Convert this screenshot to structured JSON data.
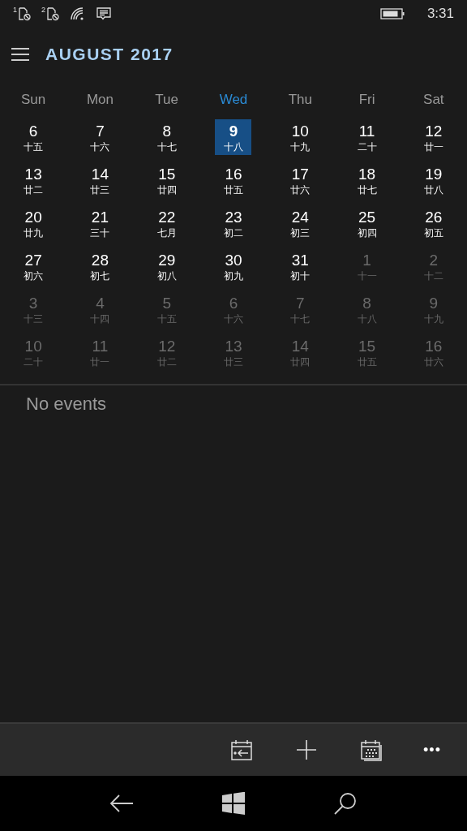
{
  "status_bar": {
    "sims": [
      "1",
      "2"
    ],
    "time": "3:31"
  },
  "header": {
    "title": "AUGUST 2017"
  },
  "weekdays": [
    {
      "label": "Sun",
      "selected": false
    },
    {
      "label": "Mon",
      "selected": false
    },
    {
      "label": "Tue",
      "selected": false
    },
    {
      "label": "Wed",
      "selected": true
    },
    {
      "label": "Thu",
      "selected": false
    },
    {
      "label": "Fri",
      "selected": false
    },
    {
      "label": "Sat",
      "selected": false
    }
  ],
  "weeks": [
    [
      {
        "day": "6",
        "lunar": "十五",
        "in_month": true,
        "selected": false
      },
      {
        "day": "7",
        "lunar": "十六",
        "in_month": true,
        "selected": false
      },
      {
        "day": "8",
        "lunar": "十七",
        "in_month": true,
        "selected": false
      },
      {
        "day": "9",
        "lunar": "十八",
        "in_month": true,
        "selected": true
      },
      {
        "day": "10",
        "lunar": "十九",
        "in_month": true,
        "selected": false
      },
      {
        "day": "11",
        "lunar": "二十",
        "in_month": true,
        "selected": false
      },
      {
        "day": "12",
        "lunar": "廿一",
        "in_month": true,
        "selected": false
      }
    ],
    [
      {
        "day": "13",
        "lunar": "廿二",
        "in_month": true,
        "selected": false
      },
      {
        "day": "14",
        "lunar": "廿三",
        "in_month": true,
        "selected": false
      },
      {
        "day": "15",
        "lunar": "廿四",
        "in_month": true,
        "selected": false
      },
      {
        "day": "16",
        "lunar": "廿五",
        "in_month": true,
        "selected": false
      },
      {
        "day": "17",
        "lunar": "廿六",
        "in_month": true,
        "selected": false
      },
      {
        "day": "18",
        "lunar": "廿七",
        "in_month": true,
        "selected": false
      },
      {
        "day": "19",
        "lunar": "廿八",
        "in_month": true,
        "selected": false
      }
    ],
    [
      {
        "day": "20",
        "lunar": "廿九",
        "in_month": true,
        "selected": false
      },
      {
        "day": "21",
        "lunar": "三十",
        "in_month": true,
        "selected": false
      },
      {
        "day": "22",
        "lunar": "七月",
        "in_month": true,
        "selected": false
      },
      {
        "day": "23",
        "lunar": "初二",
        "in_month": true,
        "selected": false
      },
      {
        "day": "24",
        "lunar": "初三",
        "in_month": true,
        "selected": false
      },
      {
        "day": "25",
        "lunar": "初四",
        "in_month": true,
        "selected": false
      },
      {
        "day": "26",
        "lunar": "初五",
        "in_month": true,
        "selected": false
      }
    ],
    [
      {
        "day": "27",
        "lunar": "初六",
        "in_month": true,
        "selected": false
      },
      {
        "day": "28",
        "lunar": "初七",
        "in_month": true,
        "selected": false
      },
      {
        "day": "29",
        "lunar": "初八",
        "in_month": true,
        "selected": false
      },
      {
        "day": "30",
        "lunar": "初九",
        "in_month": true,
        "selected": false
      },
      {
        "day": "31",
        "lunar": "初十",
        "in_month": true,
        "selected": false
      },
      {
        "day": "1",
        "lunar": "十一",
        "in_month": false,
        "selected": false
      },
      {
        "day": "2",
        "lunar": "十二",
        "in_month": false,
        "selected": false
      }
    ],
    [
      {
        "day": "3",
        "lunar": "十三",
        "in_month": false,
        "selected": false
      },
      {
        "day": "4",
        "lunar": "十四",
        "in_month": false,
        "selected": false
      },
      {
        "day": "5",
        "lunar": "十五",
        "in_month": false,
        "selected": false
      },
      {
        "day": "6",
        "lunar": "十六",
        "in_month": false,
        "selected": false
      },
      {
        "day": "7",
        "lunar": "十七",
        "in_month": false,
        "selected": false
      },
      {
        "day": "8",
        "lunar": "十八",
        "in_month": false,
        "selected": false
      },
      {
        "day": "9",
        "lunar": "十九",
        "in_month": false,
        "selected": false
      }
    ],
    [
      {
        "day": "10",
        "lunar": "二十",
        "in_month": false,
        "selected": false
      },
      {
        "day": "11",
        "lunar": "廿一",
        "in_month": false,
        "selected": false
      },
      {
        "day": "12",
        "lunar": "廿二",
        "in_month": false,
        "selected": false
      },
      {
        "day": "13",
        "lunar": "廿三",
        "in_month": false,
        "selected": false
      },
      {
        "day": "14",
        "lunar": "廿四",
        "in_month": false,
        "selected": false
      },
      {
        "day": "15",
        "lunar": "廿五",
        "in_month": false,
        "selected": false
      },
      {
        "day": "16",
        "lunar": "廿六",
        "in_month": false,
        "selected": false
      }
    ]
  ],
  "events": {
    "empty_text": "No events"
  },
  "app_bar": {
    "more": "•••"
  }
}
